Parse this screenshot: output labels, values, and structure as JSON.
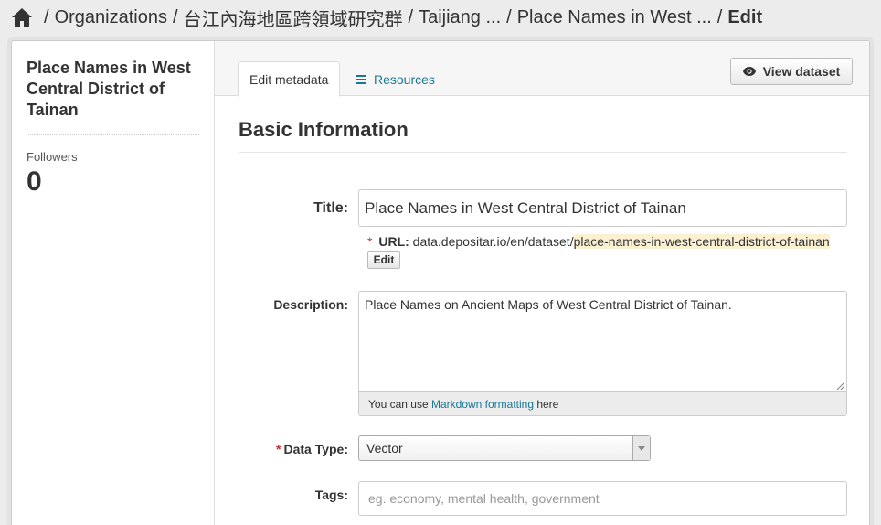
{
  "breadcrumb": {
    "items": [
      "Organizations",
      "台江內海地區跨領域研究群",
      "Taijiang ...",
      "Place Names in West ...",
      "Edit"
    ],
    "separator": "/"
  },
  "sidebar": {
    "title": "Place Names in West Central District of Tainan",
    "followers_label": "Followers",
    "followers_count": "0"
  },
  "tabs": {
    "edit_metadata": "Edit metadata",
    "resources": "Resources"
  },
  "view_dataset_label": "View dataset",
  "section_heading": "Basic Information",
  "form": {
    "title_label": "Title:",
    "title_value": "Place Names in West Central District of Tainan",
    "url_required": "*",
    "url_label": "URL:",
    "url_base": "data.depositar.io/en/dataset/",
    "url_slug": "place-names-in-west-central-district-of-tainan",
    "url_edit_label": "Edit",
    "description_label": "Description:",
    "description_value": "Place Names on Ancient Maps of West Central District of Tainan.",
    "markdown_hint_pre": "You can use ",
    "markdown_hint_link": "Markdown formatting",
    "markdown_hint_post": " here",
    "data_type_required": "*",
    "data_type_label": "Data Type:",
    "data_type_value": "Vector",
    "tags_label": "Tags:",
    "tags_placeholder": "eg. economy, mental health, government"
  },
  "colors": {
    "link": "#187794",
    "required": "#c6303e",
    "slug_highlight": "#fcf0d2"
  }
}
